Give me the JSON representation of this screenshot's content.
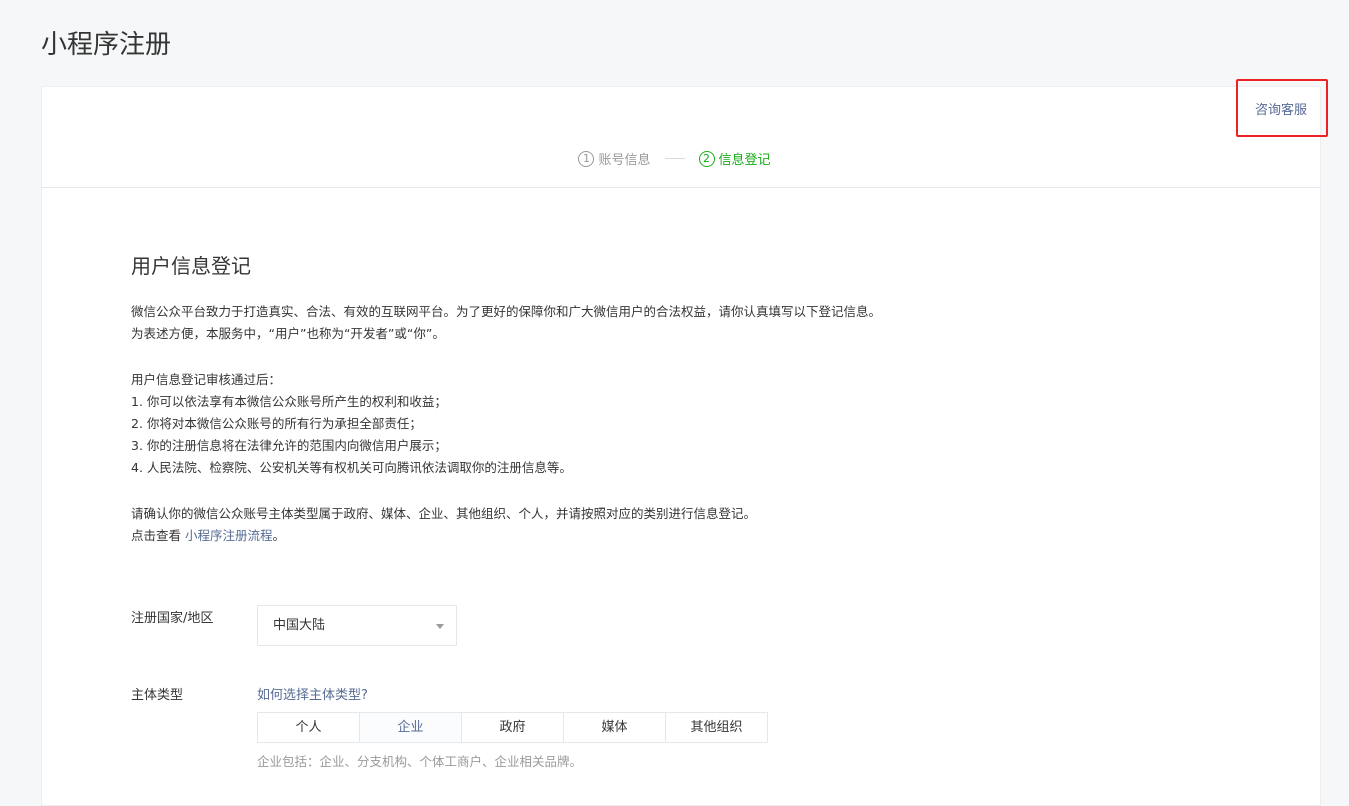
{
  "page": {
    "title": "小程序注册"
  },
  "header": {
    "service_link": "咨询客服"
  },
  "steps": [
    {
      "num": "1",
      "label": "账号信息",
      "state": "done"
    },
    {
      "num": "2",
      "label": "信息登记",
      "state": "active"
    }
  ],
  "main": {
    "section_title": "用户信息登记",
    "intro_line1": "微信公众平台致力于打造真实、合法、有效的互联网平台。为了更好的保障你和广大微信用户的合法权益，请你认真填写以下登记信息。",
    "intro_line2": "为表述方便，本服务中，“用户”也称为“开发者”或“你”。",
    "after_title": "用户信息登记审核通过后：",
    "after_items": [
      "1. 你可以依法享有本微信公众账号所产生的权利和收益；",
      "2. 你将对本微信公众账号的所有行为承担全部责任；",
      "3. 你的注册信息将在法律允许的范围内向微信用户展示；",
      "4. 人民法院、检察院、公安机关等有权机关可向腾讯依法调取你的注册信息等。"
    ],
    "confirm_line": "请确认你的微信公众账号主体类型属于政府、媒体、企业、其他组织、个人，并请按照对应的类别进行信息登记。",
    "view_prefix": "点击查看 ",
    "view_link": "小程序注册流程",
    "view_suffix": "。"
  },
  "form": {
    "country_label": "注册国家/地区",
    "country_value": "中国大陆",
    "subject_label": "主体类型",
    "subject_help": "如何选择主体类型?",
    "subject_types": [
      "个人",
      "企业",
      "政府",
      "媒体",
      "其他组织"
    ],
    "subject_selected": "企业",
    "subject_note": "企业包括：企业、分支机构、个体工商户、企业相关品牌。"
  },
  "colors": {
    "accent_green": "#1aad19",
    "link_blue": "#576b95",
    "highlight_red": "#ed2226"
  }
}
